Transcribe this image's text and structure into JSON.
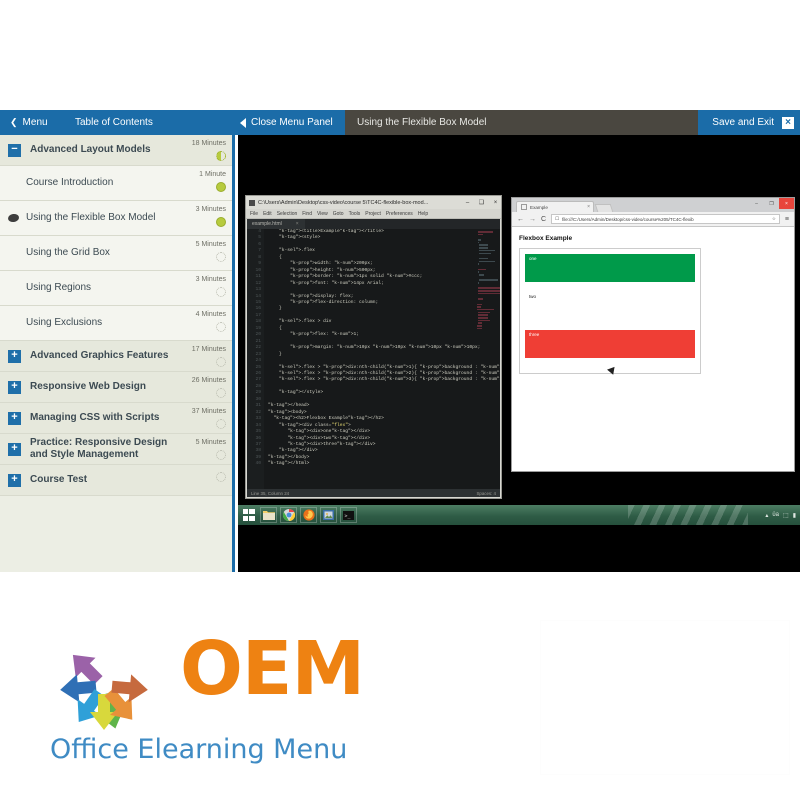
{
  "header": {
    "menu_label": "Menu",
    "toc_label": "Table of Contents",
    "close_panel_label": "Close Menu Panel",
    "lesson_title": "Using the Flexible Box Model",
    "save_exit_label": "Save and Exit",
    "close_label": "×",
    "bg_color": "#1b6ca8",
    "lesson_bar_color": "#4a4740"
  },
  "sidebar": {
    "items": [
      {
        "label": "Advanced Layout Models",
        "minutes": "18 Minutes",
        "level": "parent",
        "toggle": "−",
        "status": "half",
        "current": false
      },
      {
        "label": "Course Introduction",
        "minutes": "1 Minute",
        "level": "child",
        "status": "done",
        "current": false
      },
      {
        "label": "Using the Flexible Box Model",
        "minutes": "3 Minutes",
        "level": "child",
        "status": "done",
        "current": true
      },
      {
        "label": "Using the Grid Box",
        "minutes": "5 Minutes",
        "level": "child",
        "status": "todo",
        "current": false
      },
      {
        "label": "Using Regions",
        "minutes": "3 Minutes",
        "level": "child",
        "status": "todo",
        "current": false
      },
      {
        "label": "Using Exclusions",
        "minutes": "4 Minutes",
        "level": "child",
        "status": "todo",
        "current": false
      },
      {
        "label": "Advanced Graphics Features",
        "minutes": "17 Minutes",
        "level": "parent",
        "toggle": "+",
        "status": "todo",
        "current": false
      },
      {
        "label": "Responsive Web Design",
        "minutes": "26 Minutes",
        "level": "parent",
        "toggle": "+",
        "status": "todo",
        "current": false
      },
      {
        "label": "Managing CSS with Scripts",
        "minutes": "37 Minutes",
        "level": "parent",
        "toggle": "+",
        "status": "todo",
        "current": false
      },
      {
        "label": "Practice: Responsive Design and Style Management",
        "minutes": "5 Minutes",
        "level": "parent",
        "toggle": "+",
        "status": "todo",
        "current": false
      },
      {
        "label": "Course Test",
        "minutes": "",
        "level": "parent",
        "toggle": "+",
        "status": "todo",
        "current": false
      }
    ],
    "bg_color": "#eceee4",
    "accent_color": "#1b6ca8",
    "progress_done_color": "#b7cb3e"
  },
  "video": {
    "editor": {
      "title": "C:\\Users\\Admin\\Desktop\\css-video\\course 5\\TC4C-flexible-box-mod...",
      "menu": [
        "File",
        "Edit",
        "Selection",
        "Find",
        "View",
        "Goto",
        "Tools",
        "Project",
        "Preferences",
        "Help"
      ],
      "tab_name": "example.html",
      "tab_close": "×",
      "minimize": "–",
      "maximize": "❑",
      "close": "×",
      "first_line_number": 4,
      "code_lines": [
        "    <title>Example</title>",
        "    <style>",
        "",
        "    .flex",
        "    {",
        "        width: 200px;",
        "        height: 500px;",
        "        border: 1px solid #ccc;",
        "        font: 14px Arial;",
        "",
        "        display: flex;",
        "        flex-direction: column;",
        "    }",
        "",
        "    .flex > div",
        "    {",
        "        flex: 1;",
        "",
        "        margin: 10px 10px 10px 10px;",
        "    }",
        "",
        "    .flex > div:nth-child(1){ background : #009A4A; }",
        "    .flex > div:nth-child(2){ background : #FFFFFF; }",
        "    .flex > div:nth-child(3){ background : #EF3E35; }",
        "",
        "    </style>",
        "",
        "</head>",
        "<body>",
        "  <h2>Flexbox Example</h2>",
        "    <div class=\"flex\">",
        "       <div>one</div>",
        "       <div>two</div>",
        "       <div>three</div>",
        "    </div>",
        "</body>",
        "</html>"
      ],
      "status_left": "Line 35, Column 24",
      "status_right": "Spaces: 4"
    },
    "browser": {
      "tab_title": "Example",
      "tab_close": "×",
      "back_icon": "←",
      "forward_icon": "→",
      "reload_icon": "C",
      "url": "file:///C:/Users/Admin/Desktop/css-video/course%205/TC4C-flexib",
      "star_icon": "☆",
      "menu_icon": "≡",
      "minimize": "–",
      "maximize": "❐",
      "close": "×",
      "page_heading": "Flexbox Example",
      "boxes": [
        {
          "label": "one",
          "color": "#009A4A"
        },
        {
          "label": "two",
          "color": "#FFFFFF"
        },
        {
          "label": "three",
          "color": "#EF3E35"
        }
      ]
    },
    "taskbar": {
      "start_name": "windows-start",
      "apps": [
        "file-explorer",
        "google-chrome",
        "mozilla-firefox",
        "image-viewer",
        "command-prompt"
      ],
      "tray": [
        "▴",
        "ὐa",
        "⬚",
        "▮"
      ]
    }
  },
  "logo": {
    "wordmark": "OEM",
    "tagline": "Office Elearning Menu",
    "wordmark_color": "#ee8212",
    "tagline_color": "#3f8bc4",
    "arrow_colors": [
      "#2f6fb5",
      "#9b62a8",
      "#c66a3e",
      "#2fa0d8",
      "#e8913a",
      "#5fb44a",
      "#d8d83c"
    ]
  }
}
